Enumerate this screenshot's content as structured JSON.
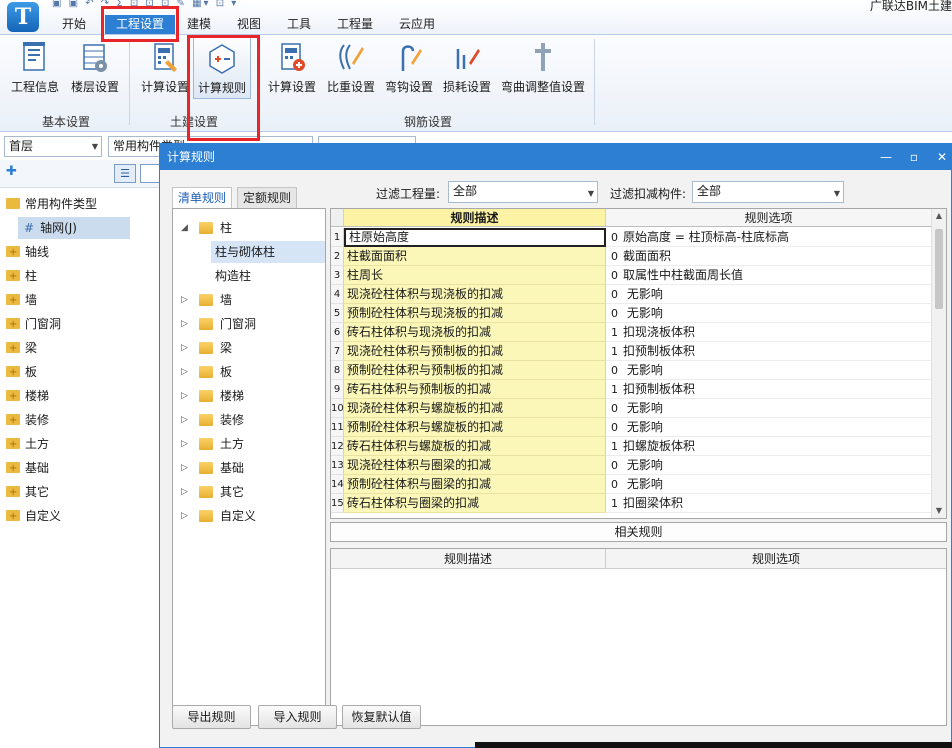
{
  "app": {
    "logo_letter": "T",
    "title": "广联达BIM土建",
    "qat_glyphs": "▣ ▣ ↶ ↷ Σ ⊡ ⊡ ⊡ ✎ ▦▾ ⊡ ▾"
  },
  "menu_tabs": [
    "开始",
    "工程设置",
    "建模",
    "视图",
    "工具",
    "工程量",
    "云应用"
  ],
  "ribbon": {
    "basic": {
      "group_label": "基本设置",
      "buttons": [
        "工程信息",
        "楼层设置"
      ]
    },
    "civil": {
      "group_label": "土建设置",
      "buttons": [
        "计算设置",
        "计算规则"
      ]
    },
    "rebar": {
      "group_label": "钢筋设置",
      "buttons": [
        "计算设置",
        "比重设置",
        "弯钩设置",
        "损耗设置",
        "弯曲调整值设置"
      ]
    }
  },
  "toolbar": {
    "floor_value": "首层",
    "component_value": "常用构件类型"
  },
  "left_tree": {
    "root": "常用构件类型",
    "selected_child": "轴网(J)",
    "items": [
      "轴线",
      "柱",
      "墙",
      "门窗洞",
      "梁",
      "板",
      "楼梯",
      "装修",
      "土方",
      "基础",
      "其它",
      "自定义"
    ]
  },
  "dialog": {
    "title": "计算规则",
    "tabs": [
      "清单规则",
      "定额规则"
    ],
    "filter_qty_label": "过滤工程量:",
    "filter_qty_value": "全部",
    "filter_deduct_label": "过滤扣减构件:",
    "filter_deduct_value": "全部",
    "tree": {
      "root": "柱",
      "children": [
        "柱与砌体柱",
        "构造柱"
      ],
      "others": [
        "墙",
        "门窗洞",
        "梁",
        "板",
        "楼梯",
        "装修",
        "土方",
        "基础",
        "其它",
        "自定义"
      ]
    },
    "grid": {
      "headers": [
        "规则描述",
        "规则选项"
      ],
      "rows": [
        {
          "n": "1",
          "desc": "柱原始高度",
          "code": "0",
          "opt": "原始高度 = 柱顶标高-柱底标高"
        },
        {
          "n": "2",
          "desc": "柱截面面积",
          "code": "0",
          "opt": "截面面积"
        },
        {
          "n": "3",
          "desc": "柱周长",
          "code": "0",
          "opt": "取属性中柱截面周长值"
        },
        {
          "n": "4",
          "desc": "现浇砼柱体积与现浇板的扣减",
          "code": "0",
          "opt": " 无影响"
        },
        {
          "n": "5",
          "desc": "预制砼柱体积与现浇板的扣减",
          "code": "0",
          "opt": " 无影响"
        },
        {
          "n": "6",
          "desc": "砖石柱体积与现浇板的扣减",
          "code": "1",
          "opt": "扣现浇板体积"
        },
        {
          "n": "7",
          "desc": "现浇砼柱体积与预制板的扣减",
          "code": "1",
          "opt": "扣预制板体积"
        },
        {
          "n": "8",
          "desc": "预制砼柱体积与预制板的扣减",
          "code": "0",
          "opt": " 无影响"
        },
        {
          "n": "9",
          "desc": "砖石柱体积与预制板的扣减",
          "code": "1",
          "opt": "扣预制板体积"
        },
        {
          "n": "10",
          "desc": "现浇砼柱体积与螺旋板的扣减",
          "code": "0",
          "opt": " 无影响"
        },
        {
          "n": "11",
          "desc": "预制砼柱体积与螺旋板的扣减",
          "code": "0",
          "opt": " 无影响"
        },
        {
          "n": "12",
          "desc": "砖石柱体积与螺旋板的扣减",
          "code": "1",
          "opt": "扣螺旋板体积"
        },
        {
          "n": "13",
          "desc": "现浇砼柱体积与圈梁的扣减",
          "code": "0",
          "opt": " 无影响"
        },
        {
          "n": "14",
          "desc": "预制砼柱体积与圈梁的扣减",
          "code": "0",
          "opt": " 无影响"
        },
        {
          "n": "15",
          "desc": "砖石柱体积与圈梁的扣减",
          "code": "1",
          "opt": "扣圈梁体积"
        }
      ]
    },
    "related_label": "相关规则",
    "related_headers": [
      "规则描述",
      "规则选项"
    ],
    "buttons": [
      "导出规则",
      "导入规则",
      "恢复默认值"
    ]
  }
}
